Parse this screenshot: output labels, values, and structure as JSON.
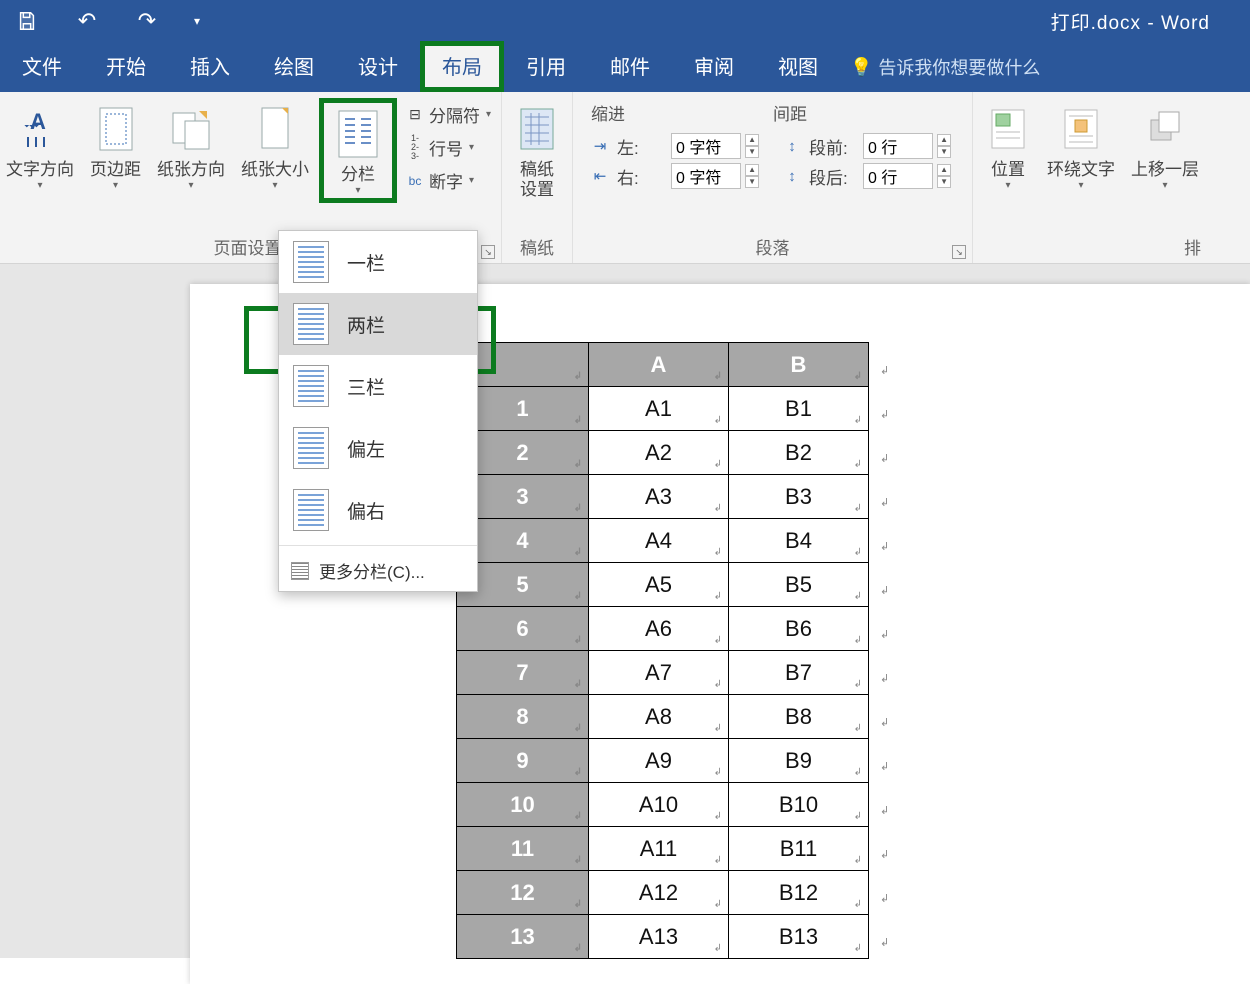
{
  "titlebar": {
    "title": "打印.docx - Word"
  },
  "tabs": {
    "file": "文件",
    "home": "开始",
    "insert": "插入",
    "draw": "绘图",
    "design": "设计",
    "layout": "布局",
    "references": "引用",
    "mailings": "邮件",
    "review": "审阅",
    "view": "视图",
    "tellme": "告诉我你想要做什么"
  },
  "ribbon": {
    "page_setup": {
      "text_direction": "文字方向",
      "margins": "页边距",
      "orientation": "纸张方向",
      "size": "纸张大小",
      "columns": "分栏",
      "breaks": "分隔符",
      "line_numbers": "行号",
      "hyphenation": "断字",
      "group_label": "页面设置"
    },
    "manuscript": {
      "btn": "稿纸\n设置",
      "group_label": "稿纸"
    },
    "paragraph": {
      "indent_header": "缩进",
      "spacing_header": "间距",
      "left_label": "左:",
      "right_label": "右:",
      "before_label": "段前:",
      "after_label": "段后:",
      "left_value": "0 字符",
      "right_value": "0 字符",
      "before_value": "0 行",
      "after_value": "0 行",
      "group_label": "段落"
    },
    "arrange": {
      "position": "位置",
      "wrap": "环绕文字",
      "bring_forward": "上移一层",
      "group_label_partial": "排"
    }
  },
  "columns_dropdown": {
    "one": "一栏",
    "two": "两栏",
    "three": "三栏",
    "left": "偏左",
    "right": "偏右",
    "more": "更多分栏(C)..."
  },
  "table": {
    "headers": [
      "",
      "A",
      "B"
    ],
    "rows": [
      {
        "n": "1",
        "a": "A1",
        "b": "B1"
      },
      {
        "n": "2",
        "a": "A2",
        "b": "B2"
      },
      {
        "n": "3",
        "a": "A3",
        "b": "B3"
      },
      {
        "n": "4",
        "a": "A4",
        "b": "B4"
      },
      {
        "n": "5",
        "a": "A5",
        "b": "B5"
      },
      {
        "n": "6",
        "a": "A6",
        "b": "B6"
      },
      {
        "n": "7",
        "a": "A7",
        "b": "B7"
      },
      {
        "n": "8",
        "a": "A8",
        "b": "B8"
      },
      {
        "n": "9",
        "a": "A9",
        "b": "B9"
      },
      {
        "n": "10",
        "a": "A10",
        "b": "B10"
      },
      {
        "n": "11",
        "a": "A11",
        "b": "B11"
      },
      {
        "n": "12",
        "a": "A12",
        "b": "B12"
      },
      {
        "n": "13",
        "a": "A13",
        "b": "B13"
      }
    ]
  }
}
